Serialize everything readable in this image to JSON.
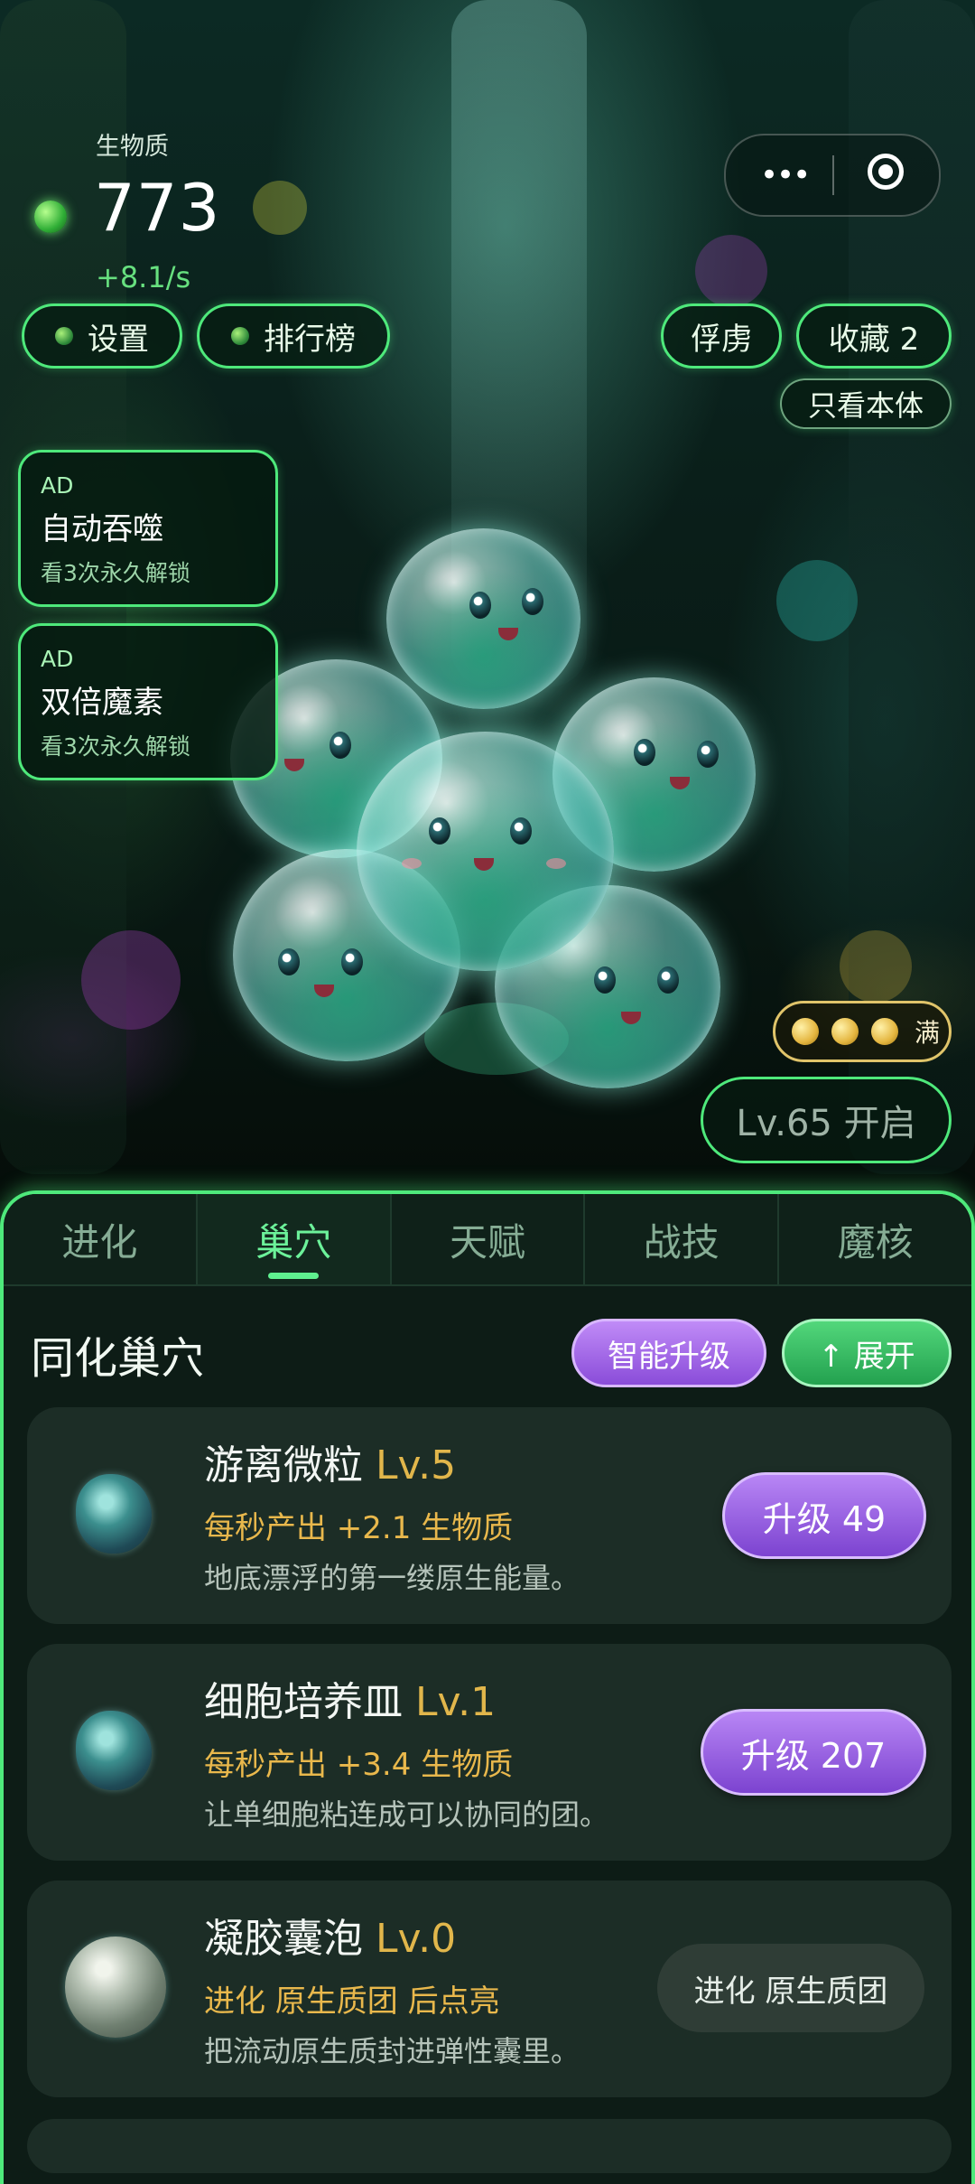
{
  "header": {
    "resource_label": "生物质",
    "resource_value": "773",
    "resource_rate": "+8.1/s",
    "menu_icon": "more-dots-icon",
    "target_icon": "target-icon"
  },
  "top_buttons": {
    "settings": "设置",
    "leaderboard": "排行榜",
    "captives": "俘虏",
    "favorites": "收藏 2",
    "only_self": "只看本体"
  },
  "ad_cards": [
    {
      "tag": "AD",
      "title": "自动吞噬",
      "subtitle": "看3次永久解锁"
    },
    {
      "tag": "AD",
      "title": "双倍魔素",
      "subtitle": "看3次永久解锁"
    }
  ],
  "full_badge": {
    "label": "满",
    "coins": 3
  },
  "level_button": "Lv.65 开启",
  "tabs": [
    {
      "label": "进化",
      "active": false
    },
    {
      "label": "巢穴",
      "active": true
    },
    {
      "label": "天赋",
      "active": false
    },
    {
      "label": "战技",
      "active": false
    },
    {
      "label": "魔核",
      "active": false
    }
  ],
  "section": {
    "title": "同化巢穴",
    "smart_upgrade": "智能升级",
    "expand": "↑ 展开"
  },
  "nests": [
    {
      "name": "游离微粒",
      "level": "Lv.5",
      "production": "每秒产出 +2.1 生物质",
      "description": "地底漂浮的第一缕原生能量。",
      "action": "升级 49"
    },
    {
      "name": "细胞培养皿",
      "level": "Lv.1",
      "production": "每秒产出 +3.4 生物质",
      "description": "让单细胞粘连成可以协同的团。",
      "action": "升级 207"
    },
    {
      "name": "凝胶囊泡",
      "level": "Lv.0",
      "production": "进化 原生质团 后点亮",
      "description": "把流动原生质封进弹性囊里。",
      "action": "进化 原生质团"
    }
  ],
  "colors": {
    "accent_green": "#4ee97b",
    "upgrade_purple": "#8a4cd9",
    "gold": "#e1b64b"
  }
}
